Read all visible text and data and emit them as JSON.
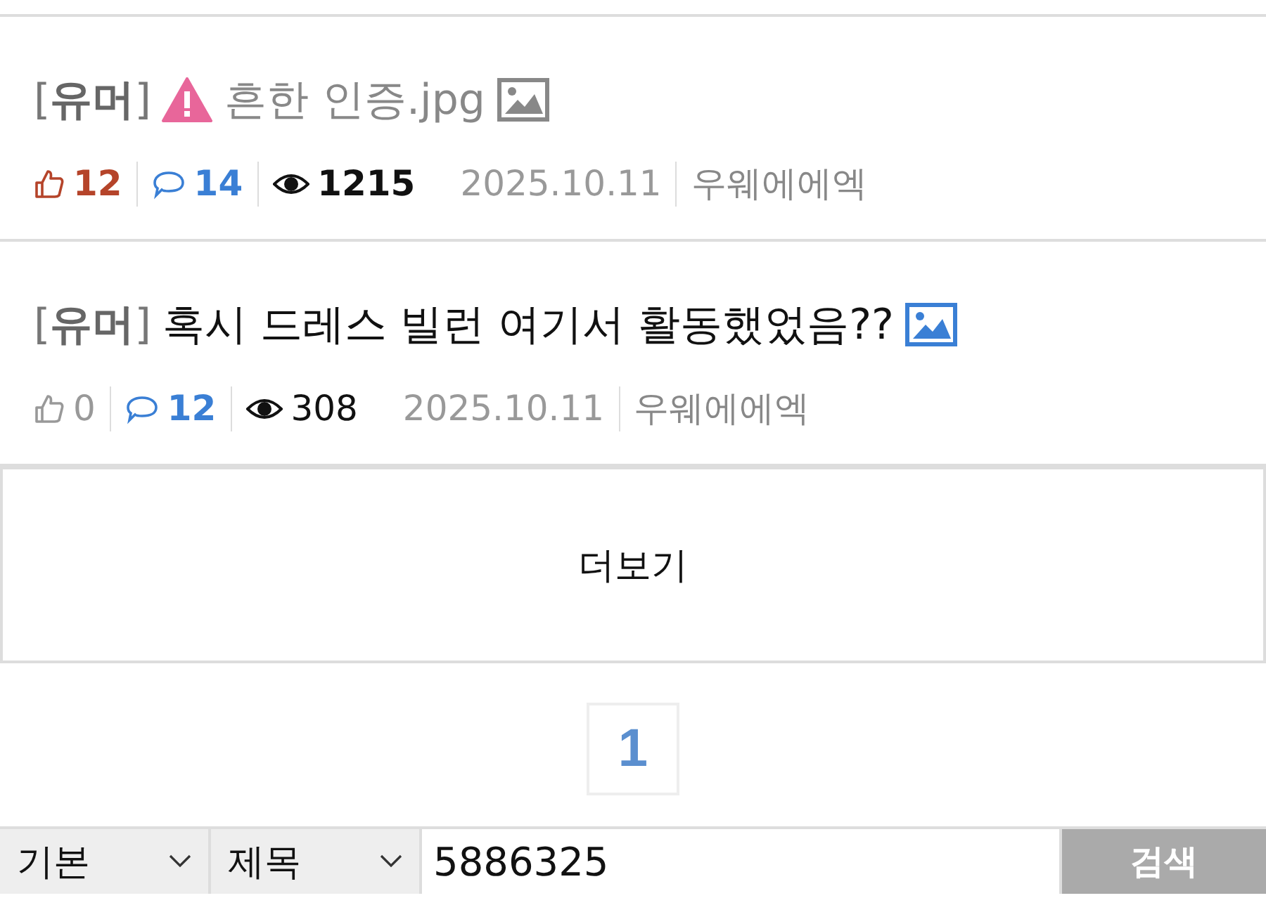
{
  "posts": [
    {
      "category": "[**유머**]",
      "title": "흔한 인증.jpg",
      "read": true,
      "warning": true,
      "has_image": true,
      "likes": "12",
      "likes_highlighted": true,
      "comments": "14",
      "views": "1215",
      "views_bold": true,
      "date": "2025.10.11",
      "author": "우웨에에엑"
    },
    {
      "category": "[**유머**]",
      "title": "혹시 드레스 빌런 여기서 활동했었음??",
      "read": false,
      "warning": false,
      "has_image": true,
      "likes": "0",
      "likes_highlighted": false,
      "comments": "12",
      "views": "308",
      "views_bold": false,
      "date": "2025.10.11",
      "author": "우웨에에엑"
    }
  ],
  "more_button": "더보기",
  "pagination": [
    {
      "label": "1",
      "selected": true
    }
  ],
  "search": {
    "scope": "기본",
    "field": "제목",
    "value": "5886325",
    "button": "검색"
  }
}
